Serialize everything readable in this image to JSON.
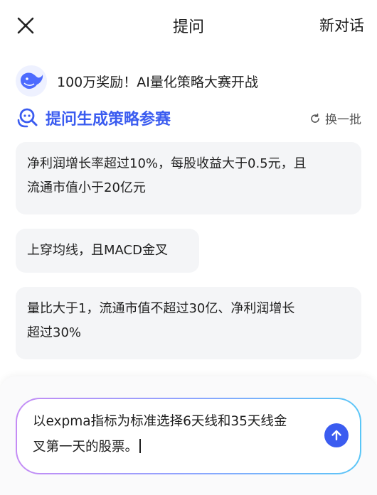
{
  "header": {
    "title": "提问",
    "new_chat_label": "新对话"
  },
  "promo": {
    "text": "100万奖励！AI量化策略大赛开战"
  },
  "section": {
    "title": "提问生成策略参赛",
    "refresh_label": "换一批"
  },
  "suggestions": [
    {
      "line1": "净利润增长率超过10%，每股收益大于0.5元，且",
      "line2": "流通市值小于20亿元"
    },
    {
      "line1": "上穿均线，且MACD金叉",
      "line2": ""
    },
    {
      "line1": "量比大于1，流通市值不超过30亿、净利润增长",
      "line2": "超过30%"
    }
  ],
  "input": {
    "line1": "以expma指标为标准选择6天线和35天线金",
    "line2": "叉第一天的股票。"
  },
  "colors": {
    "accent": "#3b5cf0",
    "card_bg": "#f4f5f7"
  }
}
